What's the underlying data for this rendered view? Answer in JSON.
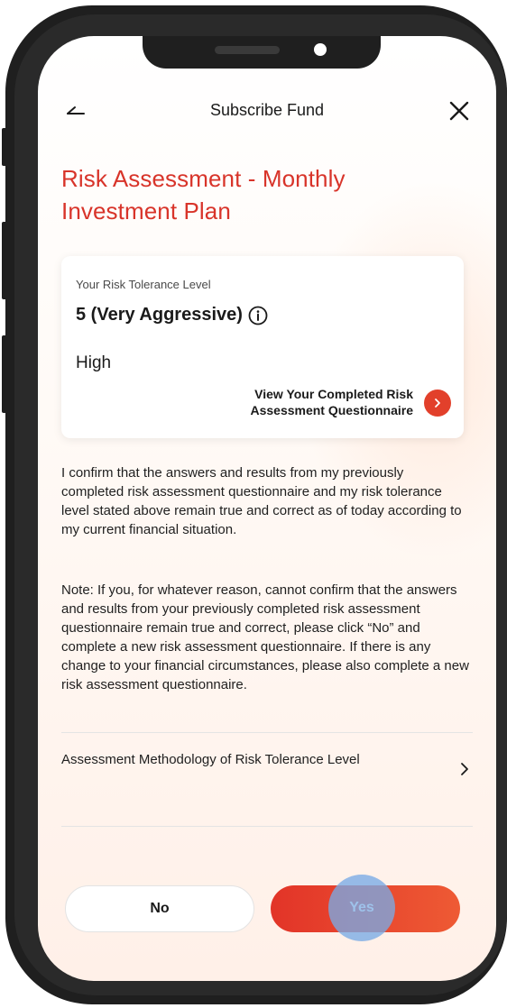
{
  "header": {
    "title": "Subscribe Fund",
    "back_icon": "back-arrow-icon",
    "close_icon": "close-icon"
  },
  "page_title": "Risk Assessment - Monthly Investment Plan",
  "card": {
    "label": "Your Risk Tolerance Level",
    "level": "5 (Very Aggressive)",
    "risk": "High",
    "link_label": "View Your Completed Risk Assessment Questionnaire",
    "info_icon": "info-icon",
    "link_icon": "chevron-right-icon"
  },
  "confirmation_text": "I confirm that the answers and results from my previously completed risk assessment questionnaire and my risk tolerance level stated above remain true and correct as of today according to my current financial situation.",
  "note_text": "Note: If you, for whatever reason, cannot confirm that the answers and results from your previously completed risk assessment questionnaire remain true and correct, please click “No” and complete a new risk assessment questionnaire. If there is any change to your financial circumstances, please also complete a new risk assessment questionnaire.",
  "methodology": {
    "label": "Assessment Methodology of Risk Tolerance Level",
    "icon": "chevron-right-icon"
  },
  "buttons": {
    "no_label": "No",
    "yes_label": "Yes"
  },
  "colors": {
    "accent": "#d8342a",
    "button_gradient_start": "#e23428",
    "button_gradient_end": "#ee5a34",
    "tap_indicator": "#78aae6"
  }
}
